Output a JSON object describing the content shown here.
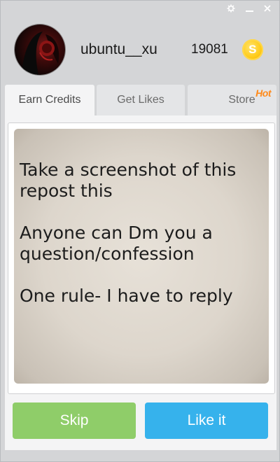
{
  "window": {
    "controls": [
      {
        "name": "settings",
        "icon": "gear-icon"
      },
      {
        "name": "minimize",
        "icon": "minimize-icon"
      },
      {
        "name": "close",
        "icon": "close-icon"
      }
    ]
  },
  "profile": {
    "username": "ubuntu__xu",
    "credits": "19081",
    "coin_symbol": "S",
    "coin_color": "#ffc514"
  },
  "tabs": [
    {
      "label": "Earn Credits",
      "active": true
    },
    {
      "label": "Get Likes",
      "active": false
    },
    {
      "label": "Store",
      "active": false,
      "badge": "Hot"
    }
  ],
  "post": {
    "lines": [
      [
        "Take a screenshot of this",
        "repost this"
      ],
      [
        "Anyone can Dm you a",
        "question/confession"
      ],
      [
        "One rule- I have to reply"
      ]
    ]
  },
  "actions": {
    "skip_label": "Skip",
    "like_label": "Like it",
    "skip_color": "#8fcd69",
    "like_color": "#36b2ec"
  }
}
